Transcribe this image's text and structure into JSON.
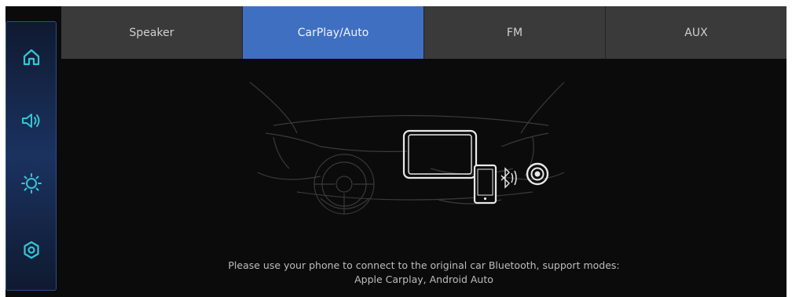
{
  "sidebar": {
    "items": [
      {
        "name": "home",
        "icon": "home-icon"
      },
      {
        "name": "volume",
        "icon": "speaker-volume-icon"
      },
      {
        "name": "brightness",
        "icon": "brightness-sun-icon"
      },
      {
        "name": "settings",
        "icon": "settings-hex-icon"
      }
    ],
    "icon_color": "#35c6d6"
  },
  "tabs": [
    {
      "label": "Speaker",
      "active": false
    },
    {
      "label": "CarPlay/Auto",
      "active": true
    },
    {
      "label": "FM",
      "active": false
    },
    {
      "label": "AUX",
      "active": false
    }
  ],
  "colors": {
    "active_tab": "#3f6fc1",
    "tab_bg": "#3a3a3a",
    "screen_bg": "#0b0b0b",
    "accent_icon": "#35c6d6"
  },
  "illustration": {
    "icons": [
      "dashboard-outline",
      "head-unit-screen-icon",
      "phone-icon",
      "bluetooth-icon",
      "speaker-icon"
    ]
  },
  "message": {
    "line1": "Please use your phone to connect to the original car Bluetooth, support modes:",
    "line2": "Apple Carplay, Android Auto"
  }
}
